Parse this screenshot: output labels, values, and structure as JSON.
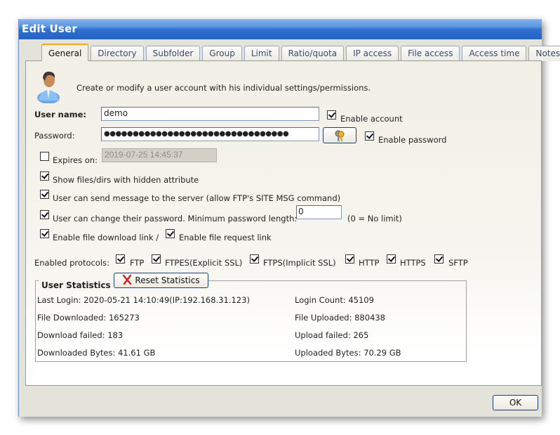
{
  "window": {
    "title": "Edit User"
  },
  "tabs": [
    {
      "label": "General",
      "active": true
    },
    {
      "label": "Directory",
      "active": false
    },
    {
      "label": "Subfolder",
      "active": false
    },
    {
      "label": "Group",
      "active": false
    },
    {
      "label": "Limit",
      "active": false
    },
    {
      "label": "Ratio/quota",
      "active": false
    },
    {
      "label": "IP access",
      "active": false
    },
    {
      "label": "File access",
      "active": false
    },
    {
      "label": "Access time",
      "active": false
    },
    {
      "label": "Notes",
      "active": false
    }
  ],
  "general": {
    "intro": "Create or modify a user account with his individual settings/permissions.",
    "username_label": "User name:",
    "username_value": "demo",
    "enable_account_label": "Enable account",
    "enable_account_checked": true,
    "password_label": "Password:",
    "password_value": "●●●●●●●●●●●●●●●●●●●●●●●●●●●●●●●●",
    "enable_password_label": "Enable password",
    "enable_password_checked": true,
    "expires_label": "Expires on:",
    "expires_checked": false,
    "expires_value": "2019-07-25 14:45:37",
    "options": [
      {
        "label": "Show files/dirs with hidden attribute",
        "checked": true
      },
      {
        "label": "User can send message to the server (allow FTP's SITE MSG command)",
        "checked": true
      },
      {
        "label": "User can change their password. Minimum password length:",
        "checked": true
      },
      {
        "label": "Enable file download link /",
        "checked": true
      },
      {
        "label": "Enable file request link",
        "checked": true
      }
    ],
    "min_password_length": "0",
    "min_password_hint": "(0 = No limit)",
    "protocols_label": "Enabled protocols:",
    "protocols": [
      {
        "label": "FTP",
        "checked": true
      },
      {
        "label": "FTPES(Explicit SSL)",
        "checked": true
      },
      {
        "label": "FTPS(Implicit SSL)",
        "checked": true
      },
      {
        "label": "HTTP",
        "checked": true
      },
      {
        "label": "HTTPS",
        "checked": true
      },
      {
        "label": "SFTP",
        "checked": true
      }
    ]
  },
  "statistics": {
    "title": "User Statistics",
    "reset_label": "Reset Statistics",
    "last_login": "Last Login: 2020-05-21 14:10:49(IP:192.168.31.123)",
    "login_count": "Login Count: 45109",
    "file_downloaded": "File Downloaded: 165273",
    "file_uploaded": "File Uploaded: 880438",
    "download_failed": "Download failed: 183",
    "upload_failed": "Upload failed: 265",
    "downloaded_bytes": "Downloaded Bytes: 41.61 GB",
    "uploaded_bytes": "Uploaded Bytes: 70.29 GB"
  },
  "footer": {
    "ok_label": "OK"
  }
}
